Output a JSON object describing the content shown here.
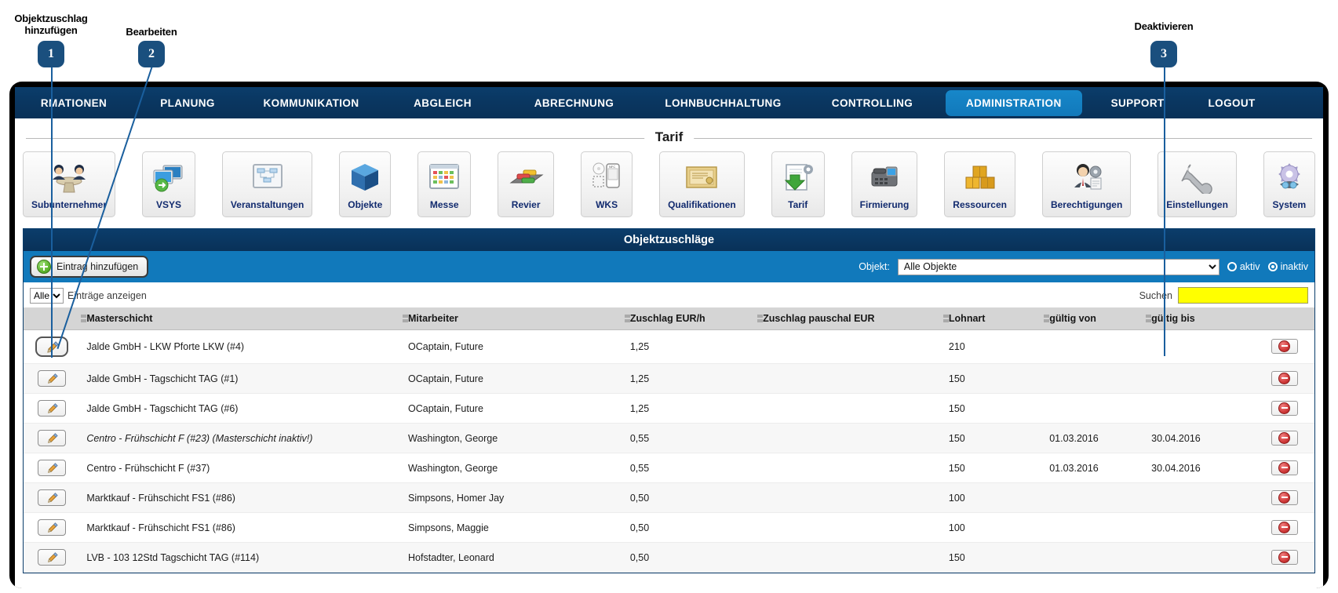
{
  "annotations": [
    {
      "number": "1",
      "label": "Objektzuschlag\nhinzufügen"
    },
    {
      "number": "2",
      "label": "Bearbeiten"
    },
    {
      "number": "3",
      "label": "Deaktivieren"
    }
  ],
  "topnav": {
    "items": [
      {
        "label": "RMATIONEN",
        "active": false
      },
      {
        "label": "PLANUNG",
        "active": false
      },
      {
        "label": "KOMMUNIKATION",
        "active": false
      },
      {
        "label": "ABGLEICH",
        "active": false
      },
      {
        "label": "ABRECHNUNG",
        "active": false
      },
      {
        "label": "LOHNBUCHHALTUNG",
        "active": false
      },
      {
        "label": "CONTROLLING",
        "active": false
      },
      {
        "label": "ADMINISTRATION",
        "active": true
      },
      {
        "label": "SUPPORT",
        "active": false
      },
      {
        "label": "LOGOUT",
        "active": false
      }
    ]
  },
  "module_strip": {
    "legend": "Tarif",
    "modules": [
      {
        "label": "Subunternehmer",
        "icon": "people-table-icon"
      },
      {
        "label": "VSYS",
        "icon": "monitors-sync-icon"
      },
      {
        "label": "Veranstaltungen",
        "icon": "whiteboard-diagram-icon"
      },
      {
        "label": "Objekte",
        "icon": "blue-cube-icon"
      },
      {
        "label": "Messe",
        "icon": "calendar-grid-icon"
      },
      {
        "label": "Revier",
        "icon": "cars-lot-icon"
      },
      {
        "label": "WKS",
        "icon": "nfc-phone-icon"
      },
      {
        "label": "Qualifikationen",
        "icon": "certificate-icon"
      },
      {
        "label": "Tarif",
        "icon": "document-green-arrow-icon"
      },
      {
        "label": "Firmierung",
        "icon": "desk-phone-icon"
      },
      {
        "label": "Ressourcen",
        "icon": "gold-boxes-icon"
      },
      {
        "label": "Berechtigungen",
        "icon": "user-gear-icon"
      },
      {
        "label": "Einstellungen",
        "icon": "wrench-icon"
      },
      {
        "label": "System",
        "icon": "gear-system-icon"
      }
    ]
  },
  "panel": {
    "title": "Objektzuschläge",
    "add_button": "Eintrag hinzufügen",
    "objekt_label": "Objekt:",
    "objekt_selected": "Alle Objekte",
    "objekt_options": [
      "Alle Objekte"
    ],
    "radio_aktiv": "aktiv",
    "radio_inaktiv": "inaktiv",
    "radio_selected": "inaktiv",
    "length_selected": "Alle",
    "length_options": [
      "Alle"
    ],
    "length_label": "Einträge anzeigen",
    "search_label": "Suchen",
    "search_value": "",
    "search_placeholder": ""
  },
  "table": {
    "columns": [
      "",
      "Masterschicht",
      "Mitarbeiter",
      "Zuschlag EUR/h",
      "Zuschlag pauschal EUR",
      "Lohnart",
      "gültig von",
      "gültig bis",
      ""
    ],
    "rows": [
      {
        "shift": "Jalde GmbH - LKW Pforte LKW (#4)",
        "employee": "OCaptain, Future",
        "surcharge_hourly": "1,25",
        "surcharge_flat": "",
        "wage_type": "210",
        "valid_from": "",
        "valid_to": "",
        "inactive": false,
        "edit_focused": true,
        "delete_focused": true
      },
      {
        "shift": "Jalde GmbH - Tagschicht TAG (#1)",
        "employee": "OCaptain, Future",
        "surcharge_hourly": "1,25",
        "surcharge_flat": "",
        "wage_type": "150",
        "valid_from": "",
        "valid_to": "",
        "inactive": false,
        "edit_focused": false,
        "delete_focused": false
      },
      {
        "shift": "Jalde GmbH - Tagschicht TAG (#6)",
        "employee": "OCaptain, Future",
        "surcharge_hourly": "1,25",
        "surcharge_flat": "",
        "wage_type": "150",
        "valid_from": "",
        "valid_to": "",
        "inactive": false,
        "edit_focused": false,
        "delete_focused": false
      },
      {
        "shift": "Centro - Frühschicht F (#23) (Masterschicht inaktiv!)",
        "employee": "Washington, George",
        "surcharge_hourly": "0,55",
        "surcharge_flat": "",
        "wage_type": "150",
        "valid_from": "01.03.2016",
        "valid_to": "30.04.2016",
        "inactive": true,
        "edit_focused": false,
        "delete_focused": false
      },
      {
        "shift": "Centro - Frühschicht F (#37)",
        "employee": "Washington, George",
        "surcharge_hourly": "0,55",
        "surcharge_flat": "",
        "wage_type": "150",
        "valid_from": "01.03.2016",
        "valid_to": "30.04.2016",
        "inactive": false,
        "edit_focused": false,
        "delete_focused": false
      },
      {
        "shift": "Marktkauf - Frühschicht FS1 (#86)",
        "employee": "Simpsons, Homer Jay",
        "surcharge_hourly": "0,50",
        "surcharge_flat": "",
        "wage_type": "100",
        "valid_from": "",
        "valid_to": "",
        "inactive": false,
        "edit_focused": false,
        "delete_focused": false
      },
      {
        "shift": "Marktkauf - Frühschicht FS1 (#86)",
        "employee": "Simpsons, Maggie",
        "surcharge_hourly": "0,50",
        "surcharge_flat": "",
        "wage_type": "100",
        "valid_from": "",
        "valid_to": "",
        "inactive": false,
        "edit_focused": false,
        "delete_focused": false
      },
      {
        "shift": "LVB - 103 12Std Tagschicht TAG (#114)",
        "employee": "Hofstadter, Leonard",
        "surcharge_hourly": "0,50",
        "surcharge_flat": "",
        "wage_type": "150",
        "valid_from": "",
        "valid_to": "",
        "inactive": false,
        "edit_focused": false,
        "delete_focused": false
      }
    ]
  },
  "colors": {
    "nav_dark": "#0b3d6b",
    "nav_active": "#1179bb",
    "toolbar_blue": "#1179bb",
    "search_yellow": "#ffff00",
    "callout_blue": "#1a4f7e",
    "module_label": "#112a6e"
  }
}
